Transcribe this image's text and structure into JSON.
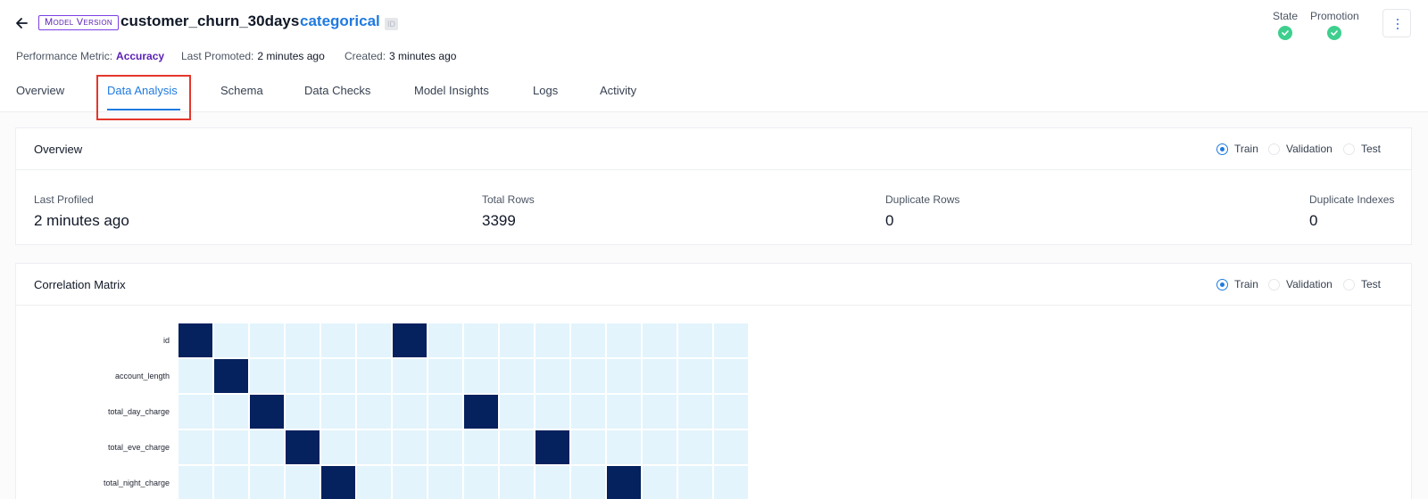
{
  "header": {
    "badge": "Model Version",
    "model_name": "customer_churn_30days",
    "model_type": "categorical",
    "id_chip": "ID",
    "meta": {
      "performance_metric_label": "Performance Metric:",
      "performance_metric_value": "Accuracy",
      "last_promoted_label": "Last Promoted:",
      "last_promoted_value": "2 minutes ago",
      "created_label": "Created:",
      "created_value": "3 minutes ago"
    },
    "state_label": "State",
    "promotion_label": "Promotion"
  },
  "tabs": [
    "Overview",
    "Data Analysis",
    "Schema",
    "Data Checks",
    "Model Insights",
    "Logs",
    "Activity"
  ],
  "active_tab": "Data Analysis",
  "overview_card": {
    "title": "Overview",
    "radios": [
      "Train",
      "Validation",
      "Test"
    ],
    "selected": "Train",
    "stats": [
      {
        "label": "Last Profiled",
        "value": "2 minutes ago"
      },
      {
        "label": "Total Rows",
        "value": "3399"
      },
      {
        "label": "Duplicate Rows",
        "value": "0"
      },
      {
        "label": "Duplicate Indexes",
        "value": "0"
      }
    ]
  },
  "correlation_card": {
    "title": "Correlation Matrix",
    "radios": [
      "Train",
      "Validation",
      "Test"
    ],
    "selected": "Train",
    "row_labels": [
      "id",
      "account_length",
      "total_day_charge",
      "total_eve_charge",
      "total_night_charge"
    ],
    "dark_cells": [
      [
        0,
        0
      ],
      [
        0,
        6
      ],
      [
        1,
        1
      ],
      [
        2,
        2
      ],
      [
        2,
        8
      ],
      [
        3,
        3
      ],
      [
        3,
        10
      ],
      [
        4,
        4
      ],
      [
        4,
        12
      ]
    ],
    "column_count": 16
  },
  "colors": {
    "accent": "#1f7ae0",
    "badge": "#5b21b6",
    "success": "#3ecf8e",
    "highlight": "#e5362b",
    "matrix_high": "#05215e",
    "matrix_low": "#e3f4fc"
  }
}
